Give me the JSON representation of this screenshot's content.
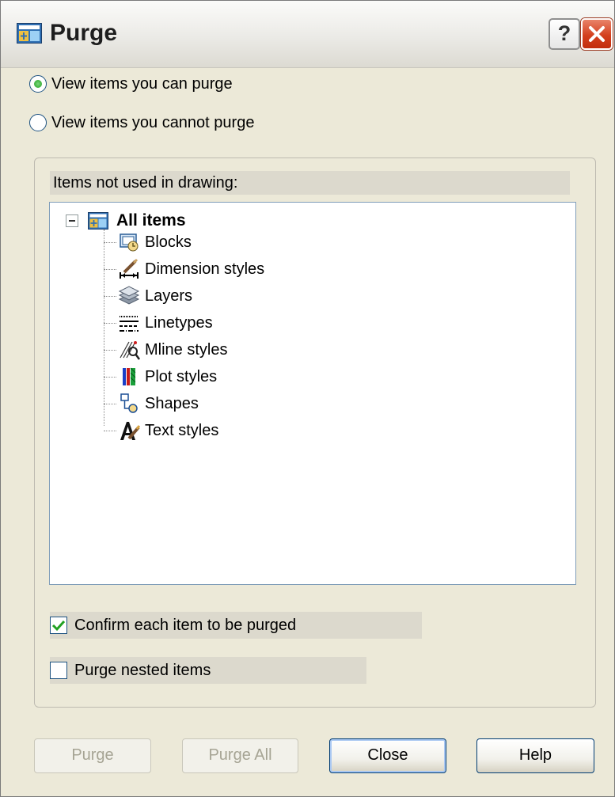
{
  "window": {
    "title": "Purge"
  },
  "title_buttons": {
    "help": "?"
  },
  "view_options": [
    {
      "label": "View items you can purge",
      "selected": true
    },
    {
      "label": "View items you cannot purge",
      "selected": false
    }
  ],
  "tree": {
    "header": "Items not used in drawing:",
    "root": {
      "label": "All items",
      "expanded": true,
      "icon": "purge-app-icon"
    },
    "items": [
      {
        "label": "Blocks",
        "icon": "blocks-icon"
      },
      {
        "label": "Dimension styles",
        "icon": "dimension-styles-icon"
      },
      {
        "label": "Layers",
        "icon": "layers-icon"
      },
      {
        "label": "Linetypes",
        "icon": "linetypes-icon"
      },
      {
        "label": "Mline styles",
        "icon": "mline-styles-icon"
      },
      {
        "label": "Plot styles",
        "icon": "plot-styles-icon"
      },
      {
        "label": "Shapes",
        "icon": "shapes-icon"
      },
      {
        "label": "Text styles",
        "icon": "text-styles-icon"
      }
    ]
  },
  "options": {
    "confirm": {
      "label": "Confirm each item to be purged",
      "checked": true
    },
    "nested": {
      "label": "Purge nested items",
      "checked": false
    }
  },
  "buttons": {
    "purge": {
      "label": "Purge",
      "enabled": false
    },
    "purge_all": {
      "label": "Purge All",
      "enabled": false
    },
    "close": {
      "label": "Close",
      "enabled": true
    },
    "help": {
      "label": "Help",
      "enabled": true
    }
  },
  "colors": {
    "dialog_bg": "#ece9d8",
    "check_green": "#21a121",
    "close_red": "#d4401e"
  }
}
